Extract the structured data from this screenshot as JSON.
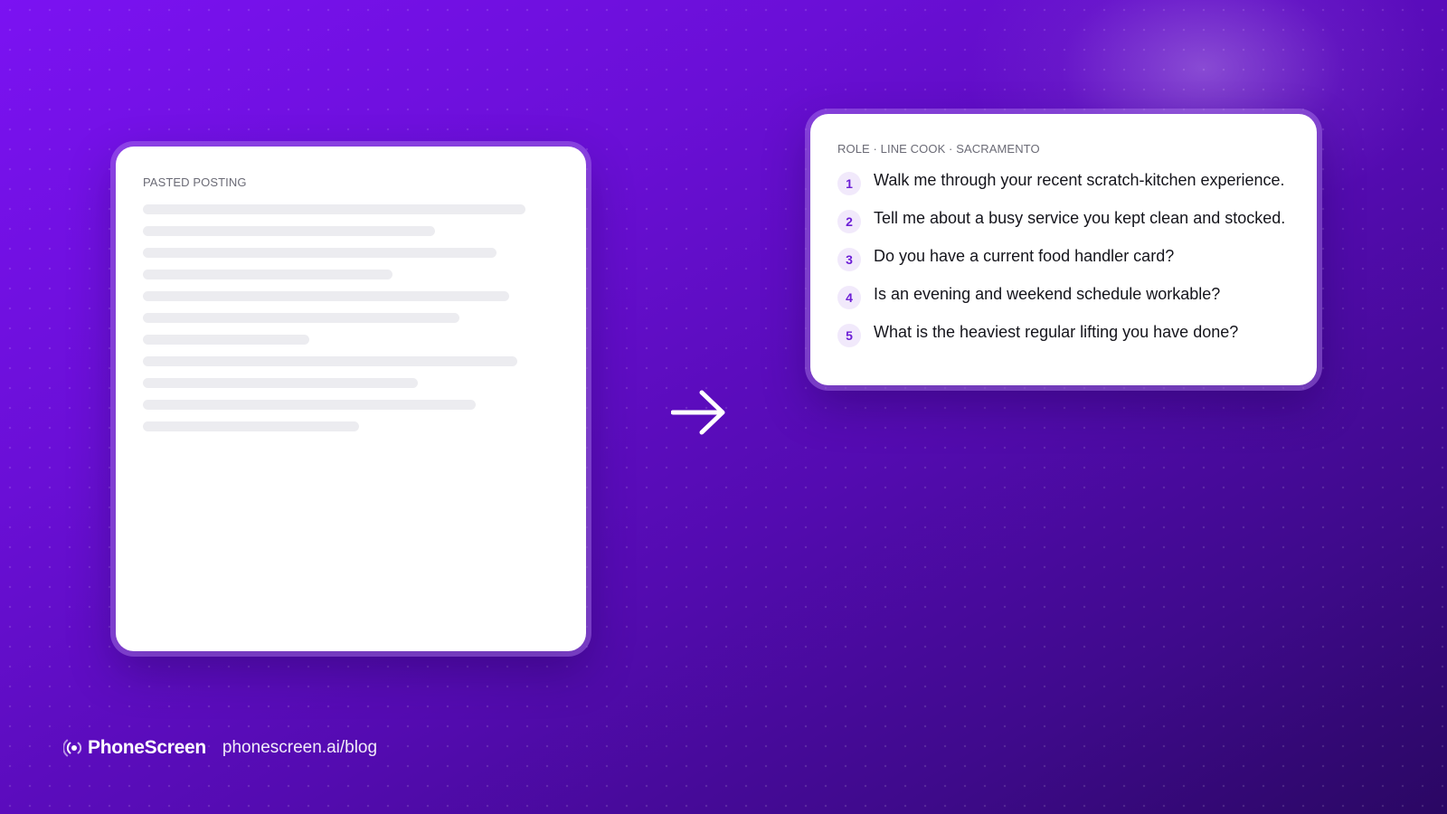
{
  "left_card": {
    "label": "PASTED POSTING",
    "placeholder_line_count": 11
  },
  "right_card": {
    "label": "ROLE · LINE COOK · SACRAMENTO",
    "questions": [
      {
        "number": "1",
        "text": "Walk me through your recent scratch-kitchen experience."
      },
      {
        "number": "2",
        "text": "Tell me about a busy service you kept clean and stocked."
      },
      {
        "number": "3",
        "text": "Do you have a current food handler card?"
      },
      {
        "number": "4",
        "text": "Is an evening and weekend schedule workable?"
      },
      {
        "number": "5",
        "text": "What is the heaviest regular lifting you have done?"
      }
    ]
  },
  "arrow_icon": "arrow-right-icon",
  "footer": {
    "brand_icon": "signal-waves-icon",
    "brand_name": "PhoneScreen",
    "url": "phonescreen.ai/blog"
  },
  "colors": {
    "background_start": "#7b12f2",
    "background_end": "#2a0763",
    "accent": "#6d1fd6",
    "number_badge_bg": "#f1e9fb",
    "card_bg": "#ffffff",
    "placeholder_line": "#ececf0"
  }
}
